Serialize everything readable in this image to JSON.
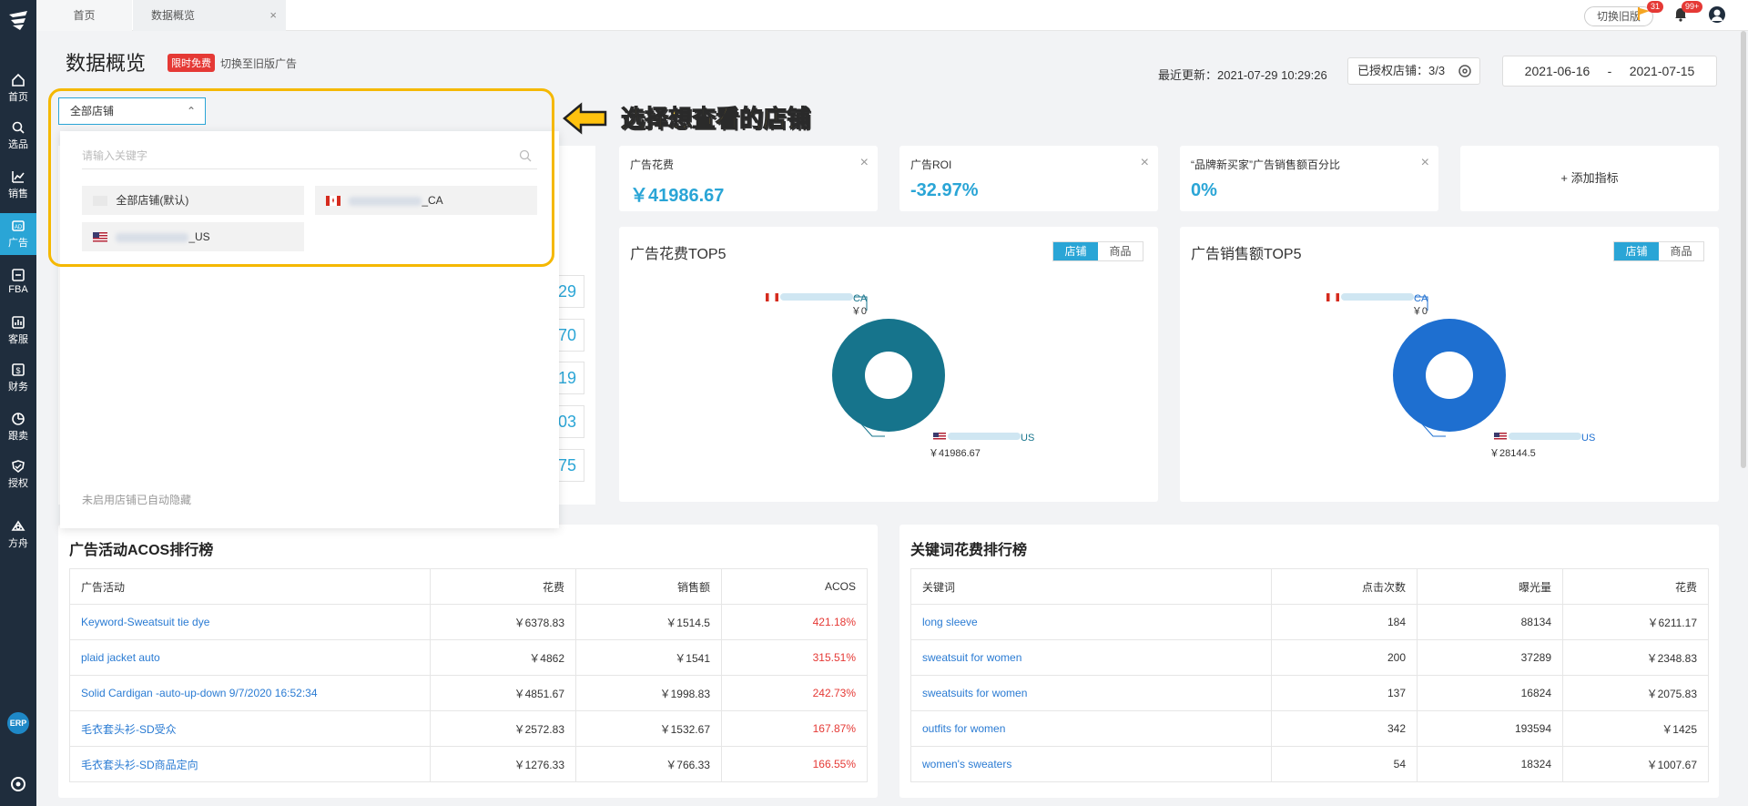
{
  "sidebar": {
    "items": [
      {
        "label": "首页",
        "icon": "home-icon"
      },
      {
        "label": "选品",
        "icon": "search-icon"
      },
      {
        "label": "销售",
        "icon": "chart-icon"
      },
      {
        "label": "广告",
        "icon": "ad-icon"
      },
      {
        "label": "FBA",
        "icon": "fba-icon"
      },
      {
        "label": "客服",
        "icon": "service-icon"
      },
      {
        "label": "财务",
        "icon": "finance-icon"
      },
      {
        "label": "跟卖",
        "icon": "follow-sell-icon"
      },
      {
        "label": "授权",
        "icon": "shield-icon"
      },
      {
        "label": "方舟",
        "icon": "ark-icon"
      }
    ],
    "erp_label": "ERP",
    "accent": "#2aa5d6"
  },
  "topbar": {
    "tabs": [
      {
        "label": "首页"
      },
      {
        "label": "数据概览"
      }
    ],
    "close_mark": "×",
    "switch_old_label": "切换旧版",
    "flag_badge": "31",
    "bell_badge": "99+"
  },
  "header": {
    "title": "数据概览",
    "free_badge": "限时免费",
    "old_ad_link": "切换至旧版广告",
    "last_update": "最近更新：2021-07-29 10:29:26",
    "auth_store": "已授权店铺：3/3",
    "date_start": "2021-06-16",
    "date_sep": "-",
    "date_end": "2021-07-15"
  },
  "store_selector": {
    "value": "全部店铺",
    "search_placeholder": "请输入关键字",
    "options": [
      {
        "label": "全部店铺(默认)"
      },
      {
        "label": "_CA"
      },
      {
        "label": "_US"
      }
    ],
    "note": "未启用店铺已自动隐藏"
  },
  "tutorial": {
    "text": "选择想查看的店铺"
  },
  "metrics": [
    {
      "label": "广告花费",
      "value": "￥41986.67"
    },
    {
      "label": "广告ROI",
      "value": "-32.97%"
    },
    {
      "label": "“品牌新买家”广告销售额百分比",
      "value": "0%"
    }
  ],
  "add_metric_label": "+ 添加指标",
  "partial_values": [
    "29",
    "70",
    "19",
    "03",
    "75"
  ],
  "charts": {
    "toggle_store": "店铺",
    "toggle_product": "商品",
    "spend": {
      "title": "广告花费TOP5",
      "ca_label": "_CA",
      "ca_value": "￥0",
      "us_label": "_US",
      "us_value": "￥41986.67",
      "color": "#16748c"
    },
    "sales": {
      "title": "广告销售额TOP5",
      "ca_label": "_CA",
      "ca_value": "￥0",
      "us_label": "_US",
      "us_value": "￥28144.5",
      "color": "#1e6fd0"
    }
  },
  "chart_data": [
    {
      "type": "pie",
      "title": "广告花费TOP5",
      "categories": [
        "_CA",
        "_US"
      ],
      "values": [
        0,
        41986.67
      ]
    },
    {
      "type": "pie",
      "title": "广告销售额TOP5",
      "categories": [
        "_CA",
        "_US"
      ],
      "values": [
        0,
        28144.5
      ]
    }
  ],
  "acos_table": {
    "title": "广告活动ACOS排行榜",
    "headers": [
      "广告活动",
      "花费",
      "销售额",
      "ACOS"
    ],
    "rows": [
      [
        "Keyword-Sweatsuit tie dye",
        "￥6378.83",
        "￥1514.5",
        "421.18%"
      ],
      [
        "plaid jacket auto",
        "￥4862",
        "￥1541",
        "315.51%"
      ],
      [
        "Solid Cardigan -auto-up-down 9/7/2020 16:52:34",
        "￥4851.67",
        "￥1998.83",
        "242.73%"
      ],
      [
        "毛衣套头衫-SD受众",
        "￥2572.83",
        "￥1532.67",
        "167.87%"
      ],
      [
        "毛衣套头衫-SD商品定向",
        "￥1276.33",
        "￥766.33",
        "166.55%"
      ]
    ]
  },
  "keyword_table": {
    "title": "关键词花费排行榜",
    "headers": [
      "关键词",
      "点击次数",
      "曝光量",
      "花费"
    ],
    "rows": [
      [
        "long sleeve",
        "184",
        "88134",
        "￥6211.17"
      ],
      [
        "sweatsuit for women",
        "200",
        "37289",
        "￥2348.83"
      ],
      [
        "sweatsuits for women",
        "137",
        "16824",
        "￥2075.83"
      ],
      [
        "outfits for women",
        "342",
        "193594",
        "￥1425"
      ],
      [
        "women's sweaters",
        "54",
        "18324",
        "￥1007.67"
      ]
    ]
  }
}
